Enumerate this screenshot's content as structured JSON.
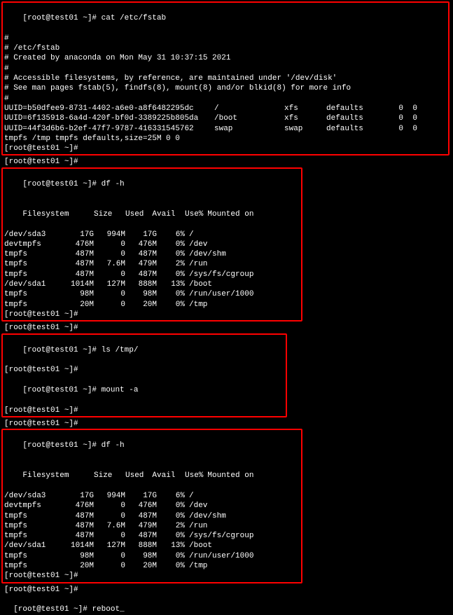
{
  "prompt_host": "[root@test01 ~]#",
  "box1": {
    "cmd": "cat /etc/fstab",
    "comments": [
      "#",
      "# /etc/fstab",
      "# Created by anaconda on Mon May 31 10:37:15 2021",
      "#",
      "# Accessible filesystems, by reference, are maintained under '/dev/disk'",
      "# See man pages fstab(5), findfs(8), mount(8) and/or blkid(8) for more info",
      "#"
    ],
    "entries": [
      {
        "uuid": "UUID=b50dfee9-8731-4402-a6e0-a8f6482295dc",
        "mp": "/",
        "type": "xfs",
        "opts": "defaults",
        "d1": "0",
        "d2": "0"
      },
      {
        "uuid": "UUID=6f135918-6a4d-420f-bf0d-3389225b805da",
        "mp": "/boot",
        "type": "xfs",
        "opts": "defaults",
        "d1": "0",
        "d2": "0"
      },
      {
        "uuid": "UUID=44f3d6b6-b2ef-47f7-9787-416331545762",
        "mp": "swap",
        "type": "swap",
        "opts": "defaults",
        "d1": "0",
        "d2": "0"
      }
    ],
    "tmpfs": "tmpfs /tmp tmpfs defaults,size=25M 0 0"
  },
  "box2": {
    "cmd": "df -h",
    "header": {
      "fs": "Filesystem",
      "size": "Size",
      "used": "Used",
      "avail": "Avail",
      "usep": "Use%",
      "mount": "Mounted on"
    },
    "rows": [
      {
        "fs": "/dev/sda3",
        "size": "17G",
        "used": "994M",
        "avail": "17G",
        "usep": "6%",
        "mount": "/"
      },
      {
        "fs": "devtmpfs",
        "size": "476M",
        "used": "0",
        "avail": "476M",
        "usep": "0%",
        "mount": "/dev"
      },
      {
        "fs": "tmpfs",
        "size": "487M",
        "used": "0",
        "avail": "487M",
        "usep": "0%",
        "mount": "/dev/shm"
      },
      {
        "fs": "tmpfs",
        "size": "487M",
        "used": "7.6M",
        "avail": "479M",
        "usep": "2%",
        "mount": "/run"
      },
      {
        "fs": "tmpfs",
        "size": "487M",
        "used": "0",
        "avail": "487M",
        "usep": "0%",
        "mount": "/sys/fs/cgroup"
      },
      {
        "fs": "/dev/sda1",
        "size": "1014M",
        "used": "127M",
        "avail": "888M",
        "usep": "13%",
        "mount": "/boot"
      },
      {
        "fs": "tmpfs",
        "size": "98M",
        "used": "0",
        "avail": "98M",
        "usep": "0%",
        "mount": "/run/user/1000"
      },
      {
        "fs": "tmpfs",
        "size": "20M",
        "used": "0",
        "avail": "20M",
        "usep": "0%",
        "mount": "/tmp"
      }
    ]
  },
  "box3": {
    "cmd1": "ls /tmp/",
    "cmd2": "mount -a"
  },
  "box4": {
    "cmd": "df -h",
    "header": {
      "fs": "Filesystem",
      "size": "Size",
      "used": "Used",
      "avail": "Avail",
      "usep": "Use%",
      "mount": "Mounted on"
    },
    "rows": [
      {
        "fs": "/dev/sda3",
        "size": "17G",
        "used": "994M",
        "avail": "17G",
        "usep": "6%",
        "mount": "/"
      },
      {
        "fs": "devtmpfs",
        "size": "476M",
        "used": "0",
        "avail": "476M",
        "usep": "0%",
        "mount": "/dev"
      },
      {
        "fs": "tmpfs",
        "size": "487M",
        "used": "0",
        "avail": "487M",
        "usep": "0%",
        "mount": "/dev/shm"
      },
      {
        "fs": "tmpfs",
        "size": "487M",
        "used": "7.6M",
        "avail": "479M",
        "usep": "2%",
        "mount": "/run"
      },
      {
        "fs": "tmpfs",
        "size": "487M",
        "used": "0",
        "avail": "487M",
        "usep": "0%",
        "mount": "/sys/fs/cgroup"
      },
      {
        "fs": "/dev/sda1",
        "size": "1014M",
        "used": "127M",
        "avail": "888M",
        "usep": "13%",
        "mount": "/boot"
      },
      {
        "fs": "tmpfs",
        "size": "98M",
        "used": "0",
        "avail": "98M",
        "usep": "0%",
        "mount": "/run/user/1000"
      },
      {
        "fs": "tmpfs",
        "size": "20M",
        "used": "0",
        "avail": "20M",
        "usep": "0%",
        "mount": "/tmp"
      }
    ]
  },
  "final_cmd": "reboot",
  "cursor": "_"
}
